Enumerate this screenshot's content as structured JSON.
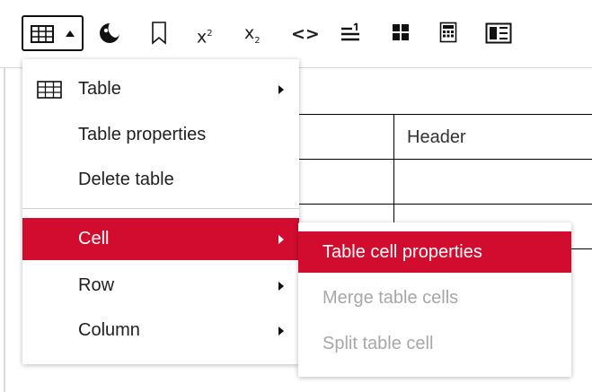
{
  "toolbar": {
    "items": [
      {
        "name": "table-icon",
        "label": "Table"
      },
      {
        "name": "color-picker-icon"
      },
      {
        "name": "bookmark-icon"
      },
      {
        "name": "superscript-icon",
        "glyph": "x²"
      },
      {
        "name": "subscript-icon",
        "glyph": "x₂"
      },
      {
        "name": "code-icon",
        "glyph": "<>"
      },
      {
        "name": "ordered-list-icon"
      },
      {
        "name": "blocks-icon"
      },
      {
        "name": "calculator-icon"
      },
      {
        "name": "layout-icon"
      }
    ],
    "superscript_glyph": "x",
    "superscript_sup": "2",
    "subscript_glyph": "x",
    "subscript_sub": "2",
    "code_glyph": "<>"
  },
  "editor": {
    "table": {
      "header_cell": "Header"
    }
  },
  "menu": {
    "items": [
      {
        "label": "Table",
        "has_submenu": true,
        "icon": "table-icon"
      },
      {
        "label": "Table properties",
        "has_submenu": false
      },
      {
        "label": "Delete table",
        "has_submenu": false
      },
      {
        "label": "Cell",
        "has_submenu": true,
        "active": true
      },
      {
        "label": "Row",
        "has_submenu": true
      },
      {
        "label": "Column",
        "has_submenu": true
      }
    ]
  },
  "submenu": {
    "items": [
      {
        "label": "Table cell properties",
        "active": true,
        "disabled": false
      },
      {
        "label": "Merge table cells",
        "active": false,
        "disabled": true
      },
      {
        "label": "Split table cell",
        "active": false,
        "disabled": true
      }
    ]
  },
  "colors": {
    "accent": "#d10c2e",
    "disabled_text": "#a7a7a7"
  }
}
